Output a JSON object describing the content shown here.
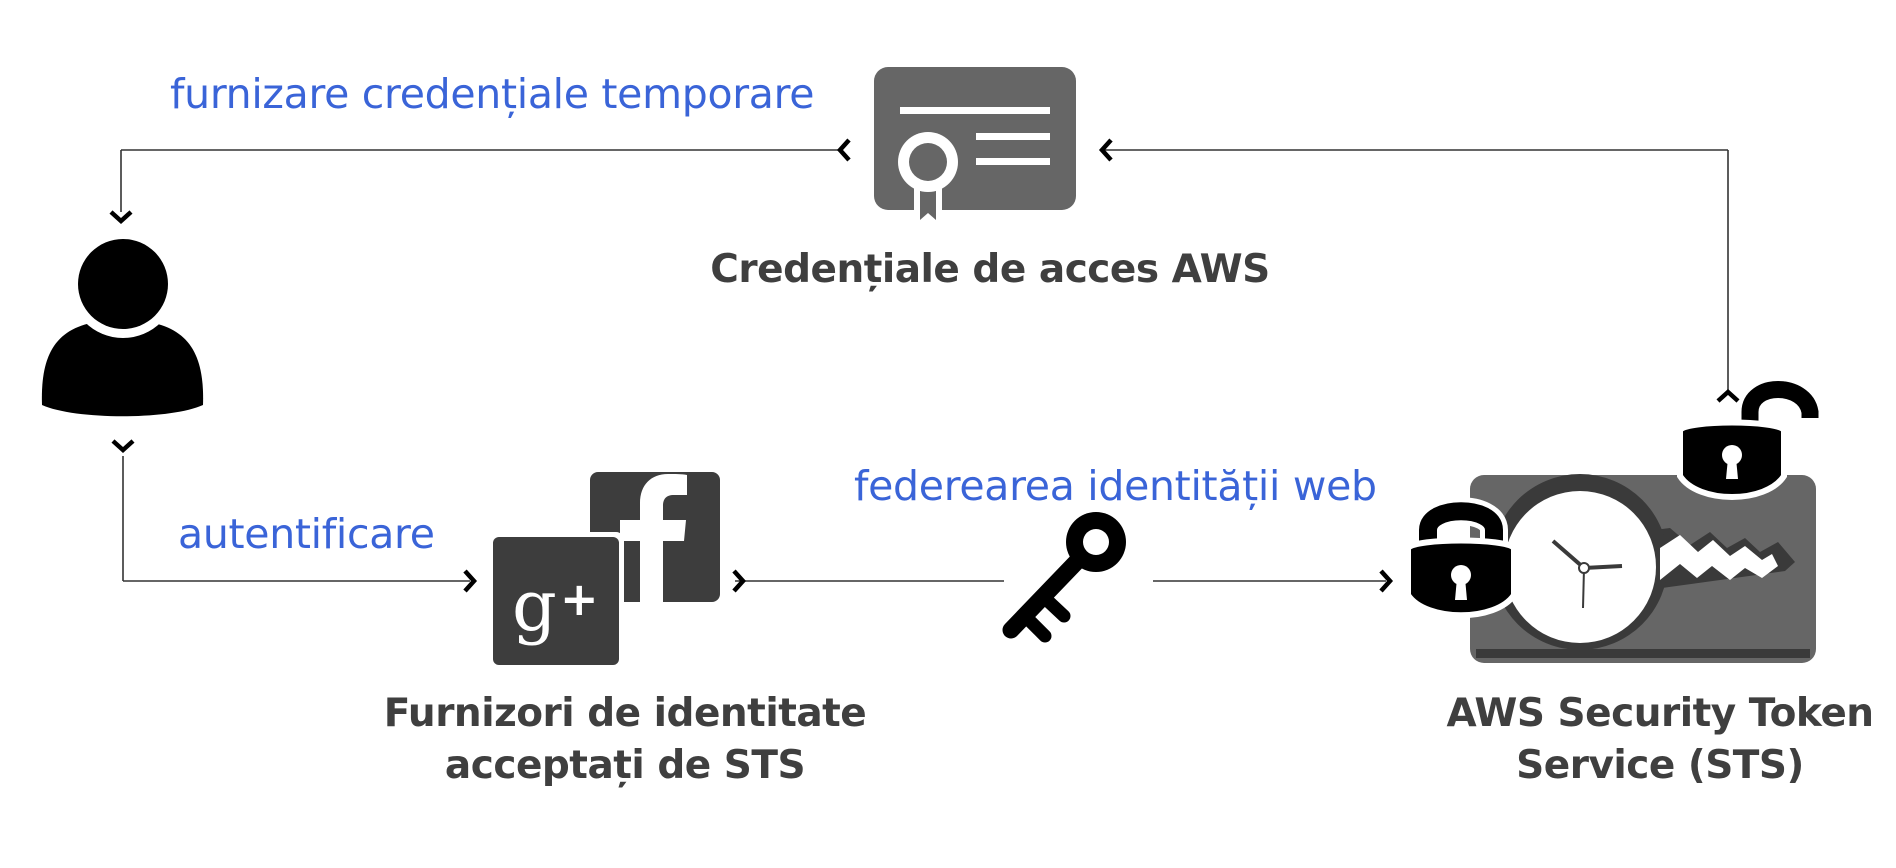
{
  "labels": {
    "temp_credentials": "furnizare credențiale temporare",
    "authentication": "autentificare",
    "web_identity_federation": "federearea identității web",
    "aws_credentials": "Credențiale de acces AWS",
    "idp_line1": "Furnizori de identitate",
    "idp_line2": "acceptați de STS",
    "sts_line1": "AWS Security Token",
    "sts_line2": "Service (STS)"
  },
  "logos": {
    "google_plus": "g+",
    "facebook": "f"
  },
  "icons": [
    "user-icon",
    "certificate-icon",
    "google-plus-icon",
    "facebook-icon",
    "key-icon",
    "sts-token-icon",
    "padlock-icon",
    "open-padlock-icon"
  ],
  "colors": {
    "label_blue": "#3a64d8",
    "label_dark": "#3f3f3f",
    "icon_gray": "#666666",
    "icon_black": "#000000",
    "logo_dark": "#3d3d3d",
    "line": "#333333"
  }
}
